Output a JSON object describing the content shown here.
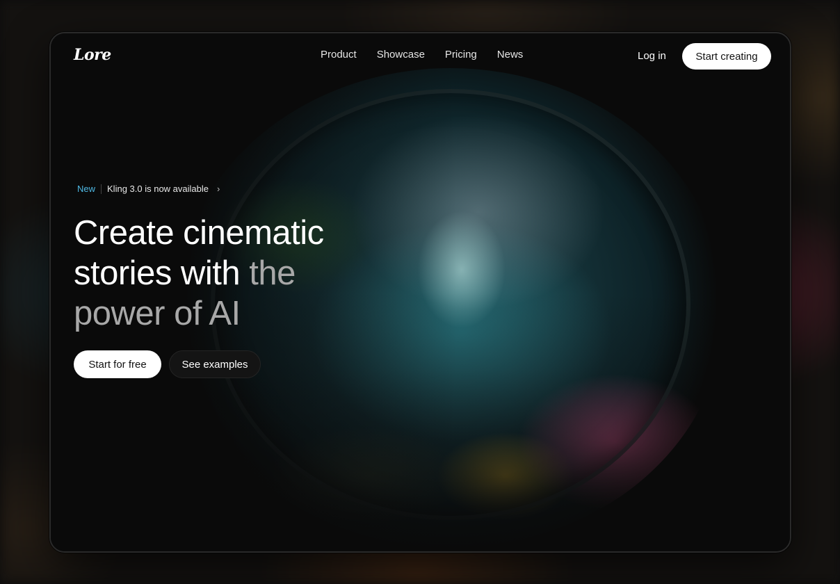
{
  "brand": {
    "logo_text": "Lore"
  },
  "nav": {
    "items": [
      {
        "label": "Product"
      },
      {
        "label": "Showcase"
      },
      {
        "label": "Pricing"
      },
      {
        "label": "News"
      }
    ],
    "login_label": "Log in",
    "cta_label": "Start creating"
  },
  "announcement": {
    "badge": "New",
    "text": "Kling 3.0 is now available",
    "chevron": "›"
  },
  "hero": {
    "headline_bright": "Create cinematic stories with",
    "headline_dim": "the power of AI",
    "primary_button": "Start for free",
    "secondary_button": "See examples"
  },
  "colors": {
    "accent_badge": "#4fb8e3",
    "background": "#0a0a0a",
    "button_light": "#ffffff"
  }
}
